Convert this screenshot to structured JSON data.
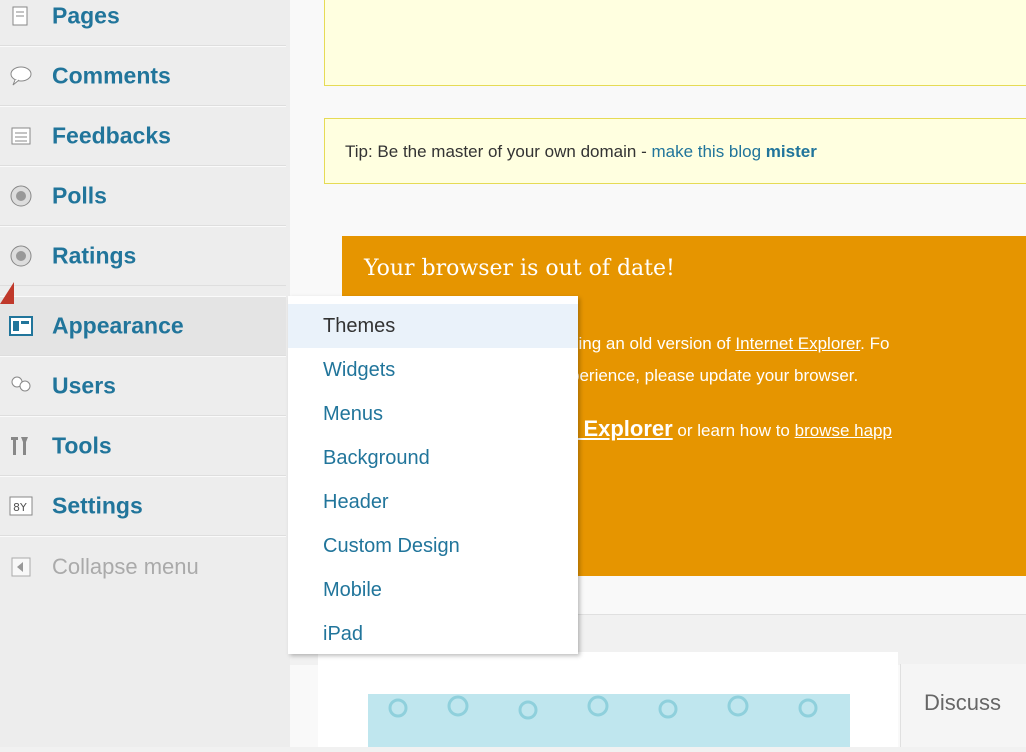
{
  "sidebar": {
    "items": [
      {
        "label": "Pages",
        "icon": "pages-icon"
      },
      {
        "label": "Comments",
        "icon": "comments-icon"
      },
      {
        "label": "Feedbacks",
        "icon": "feedbacks-icon"
      },
      {
        "label": "Polls",
        "icon": "polls-icon"
      },
      {
        "label": "Ratings",
        "icon": "ratings-icon"
      },
      {
        "label": "Appearance",
        "icon": "appearance-icon"
      },
      {
        "label": "Users",
        "icon": "users-icon"
      },
      {
        "label": "Tools",
        "icon": "tools-icon"
      },
      {
        "label": "Settings",
        "icon": "settings-icon"
      },
      {
        "label": "Collapse menu",
        "icon": "collapse-icon"
      }
    ]
  },
  "flyout": {
    "items": [
      "Themes",
      "Widgets",
      "Menus",
      "Background",
      "Header",
      "Custom Design",
      "Mobile",
      "iPad"
    ]
  },
  "tip": {
    "prefix": "Tip: Be the master of your own domain - ",
    "link": "make this blog ",
    "bold": "mister"
  },
  "browser_notice": {
    "title": "Your browser is out of date!",
    "line1_pre": "sing an old version of ",
    "line1_link": "Internet Explorer",
    "line1_post": ". Fo",
    "line2": "perience, please update your browser.",
    "line3_big": "t Explorer",
    "line3_mid": " or learn how to ",
    "line3_link": "browse happ"
  },
  "footer": {
    "discuss": "Discuss"
  },
  "colors": {
    "accent": "#21759b",
    "orange": "#e69500",
    "tip_bg": "#ffffe0"
  }
}
